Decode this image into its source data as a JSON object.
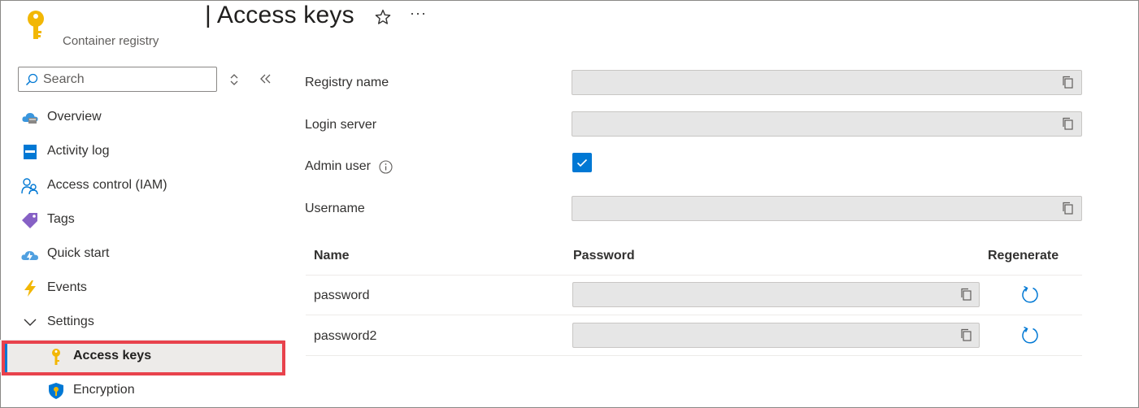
{
  "header": {
    "title": "| Access keys",
    "subtitle": "Container registry",
    "more_label": "···",
    "icon": "key-icon",
    "favorite_icon": "star-icon"
  },
  "sidebar": {
    "search_placeholder": "Search",
    "items": [
      {
        "label": "Overview",
        "icon": "cloud-icon"
      },
      {
        "label": "Activity log",
        "icon": "activity-log-icon"
      },
      {
        "label": "Access control (IAM)",
        "icon": "people-icon"
      },
      {
        "label": "Tags",
        "icon": "tag-icon"
      },
      {
        "label": "Quick start",
        "icon": "quick-start-icon"
      },
      {
        "label": "Events",
        "icon": "lightning-icon"
      },
      {
        "label": "Settings",
        "icon": "chevron-down-icon"
      },
      {
        "label": "Access keys",
        "icon": "key-icon",
        "active": true
      },
      {
        "label": "Encryption",
        "icon": "shield-icon"
      }
    ]
  },
  "form": {
    "registry_name_label": "Registry name",
    "registry_name_value": "",
    "login_server_label": "Login server",
    "login_server_value": "",
    "admin_user_label": "Admin user",
    "admin_user_checked": true,
    "username_label": "Username",
    "username_value": ""
  },
  "passwords": {
    "columns": [
      "Name",
      "Password",
      "Regenerate"
    ],
    "rows": [
      {
        "name": "password",
        "value": ""
      },
      {
        "name": "password2",
        "value": ""
      }
    ]
  },
  "colors": {
    "accent": "#0078d4",
    "highlight_border": "#e8424c",
    "key_yellow": "#f2b705",
    "field_bg": "#e6e6e6"
  }
}
